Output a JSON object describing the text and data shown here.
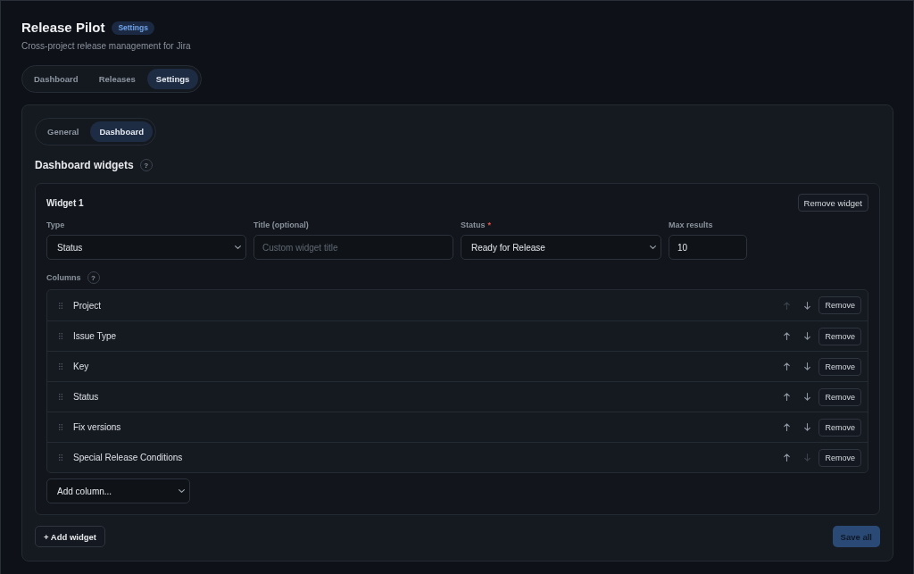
{
  "header": {
    "title": "Release Pilot",
    "badge": "Settings",
    "subtitle": "Cross-project release management for Jira"
  },
  "nav_tabs": [
    {
      "label": "Dashboard",
      "selected": false
    },
    {
      "label": "Releases",
      "selected": false
    },
    {
      "label": "Settings",
      "selected": true
    }
  ],
  "settings_panel": {
    "tabs": [
      {
        "label": "General",
        "selected": false
      },
      {
        "label": "Dashboard",
        "selected": true
      }
    ],
    "section_title": "Dashboard widgets",
    "section_help": "?",
    "widgets": [
      {
        "title": "Widget 1",
        "remove_button": "Remove widget",
        "fields": [
          {
            "kind": "select",
            "label": "Type",
            "value": "Status"
          },
          {
            "kind": "input",
            "label": "Title (optional)",
            "placeholder": "Custom widget title"
          },
          {
            "kind": "select",
            "label": "Status",
            "required_mark": "*",
            "value": "Ready for Release"
          },
          {
            "kind": "input",
            "label": "Max results",
            "value": "10"
          }
        ],
        "columns_label": "Columns",
        "columns_help": "?",
        "columns": [
          {
            "name": "Project",
            "up_disabled": true,
            "down_disabled": false,
            "remove_button": "Remove"
          },
          {
            "name": "Issue Type",
            "up_disabled": false,
            "down_disabled": false,
            "remove_button": "Remove"
          },
          {
            "name": "Key",
            "up_disabled": false,
            "down_disabled": false,
            "remove_button": "Remove"
          },
          {
            "name": "Status",
            "up_disabled": false,
            "down_disabled": false,
            "remove_button": "Remove"
          },
          {
            "name": "Fix versions",
            "up_disabled": false,
            "down_disabled": false,
            "remove_button": "Remove"
          },
          {
            "name": "Special Release Conditions",
            "up_disabled": false,
            "down_disabled": true,
            "remove_button": "Remove"
          }
        ],
        "add_column": "Add column..."
      }
    ],
    "add_widget_button": "+ Add widget",
    "save_button": {
      "label": "Save all",
      "disabled": true
    }
  }
}
